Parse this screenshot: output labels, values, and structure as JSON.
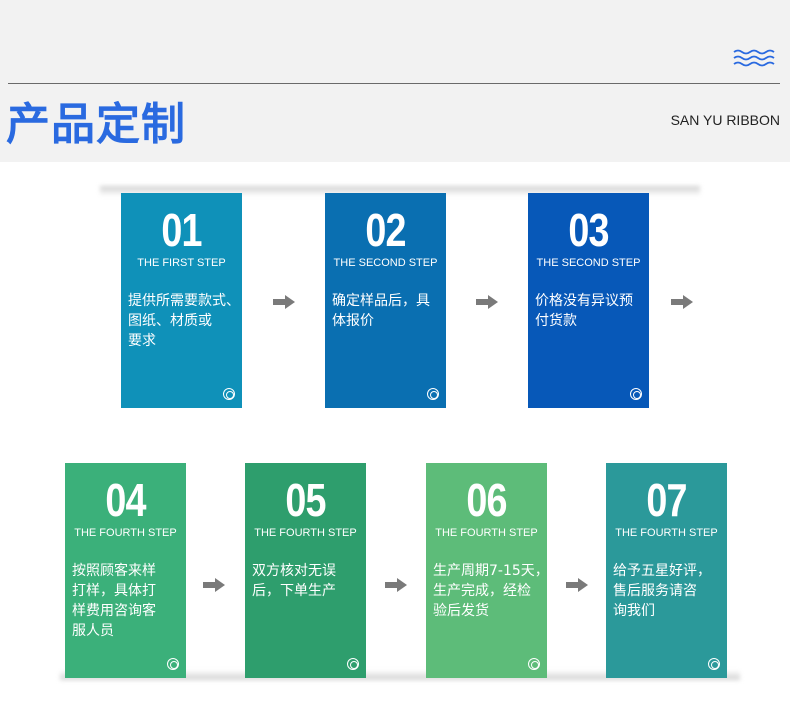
{
  "header": {
    "title": "产品定制",
    "brand": "SAN YU RIBBON"
  },
  "steps": [
    {
      "num": "01",
      "label": "THE FIRST STEP",
      "lines": [
        "提供所需要款式、",
        "图纸、材质或",
        "要求"
      ],
      "color": "#0f91b9"
    },
    {
      "num": "02",
      "label": "THE SECOND STEP",
      "lines": [
        "确定样品后，具",
        "体报价"
      ],
      "color": "#0a6fb1"
    },
    {
      "num": "03",
      "label": "THE SECOND STEP",
      "lines": [
        "价格没有异议预",
        "付货款"
      ],
      "color": "#0758b8"
    },
    {
      "num": "04",
      "label": "THE FOURTH STEP",
      "lines": [
        "按照顾客来样",
        "打样，具体打",
        "样费用咨询客",
        "服人员"
      ],
      "color": "#3bb07a"
    },
    {
      "num": "05",
      "label": "THE FOURTH STEP",
      "lines": [
        "双方核对无误",
        "后，下单生产"
      ],
      "color": "#2e9e6d"
    },
    {
      "num": "06",
      "label": "THE FOURTH STEP",
      "lines": [
        "生产周期7-15天，",
        "生产完成，经检",
        "验后发货"
      ],
      "color": "#5dbc79"
    },
    {
      "num": "07",
      "label": "THE FOURTH STEP",
      "lines": [
        "给予五星好评，",
        "售后服务请咨",
        "询我们"
      ],
      "color": "#2b999a"
    }
  ]
}
